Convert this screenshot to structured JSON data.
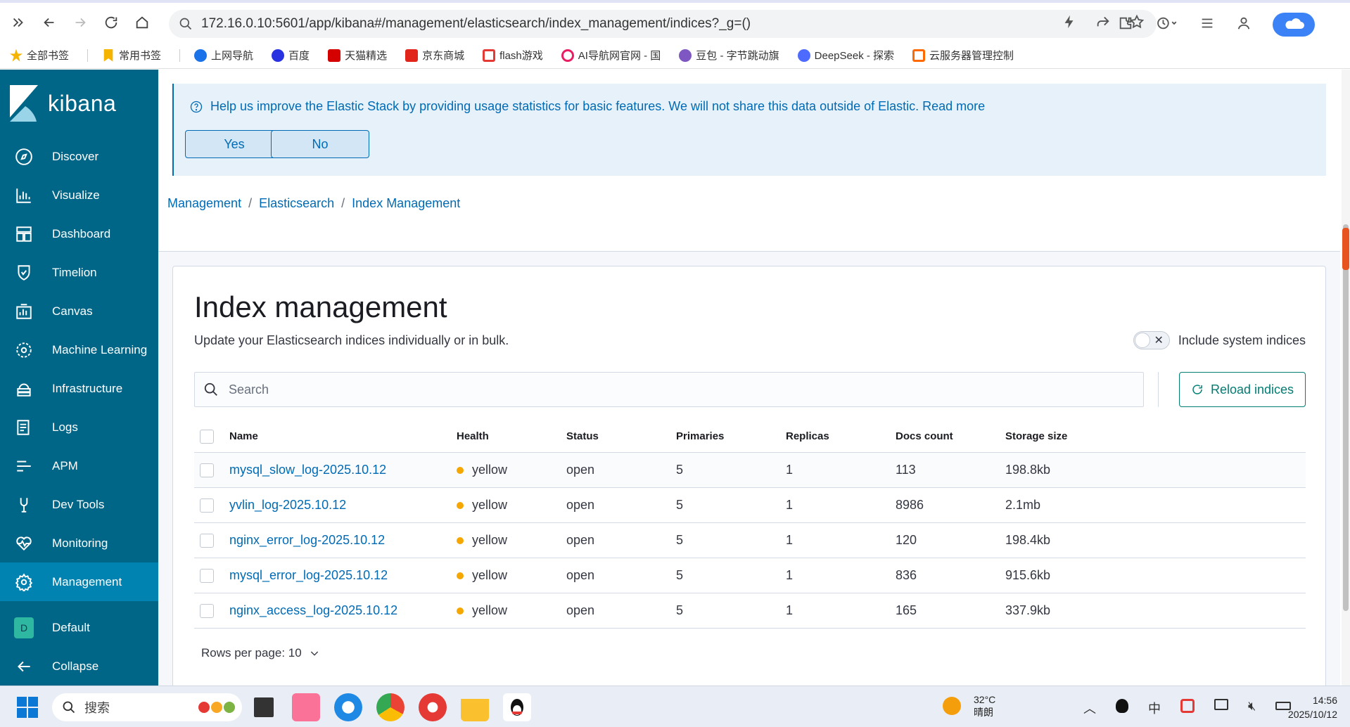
{
  "browser": {
    "url": "172.16.0.10:5601/app/kibana#/management/elasticsearch/index_management/indices?_g=()"
  },
  "bookmarks": [
    {
      "label": "全部书签",
      "color": "#f5b400"
    },
    {
      "label": "常用书签",
      "color": "#f5b400"
    },
    {
      "label": "上网导航",
      "color": "#1a73e8"
    },
    {
      "label": "百度",
      "color": "#2932e1"
    },
    {
      "label": "天猫精选",
      "color": "#d50000"
    },
    {
      "label": "京东商城",
      "color": "#e1251b"
    },
    {
      "label": "flash游戏",
      "color": "#e53935"
    },
    {
      "label": "AI导航网官网 - 国",
      "color": "#e91e63"
    },
    {
      "label": "豆包 - 字节跳动旗",
      "color": "#7e57c2"
    },
    {
      "label": "DeepSeek - 探索",
      "color": "#4d6bfe"
    },
    {
      "label": "云服务器管理控制",
      "color": "#ff6a00"
    }
  ],
  "sidebar": {
    "brand": "kibana",
    "items": [
      {
        "label": "Discover",
        "icon": "compass-icon"
      },
      {
        "label": "Visualize",
        "icon": "chart-icon"
      },
      {
        "label": "Dashboard",
        "icon": "dashboard-icon"
      },
      {
        "label": "Timelion",
        "icon": "shield-icon"
      },
      {
        "label": "Canvas",
        "icon": "canvas-icon"
      },
      {
        "label": "Machine Learning",
        "icon": "ml-icon"
      },
      {
        "label": "Infrastructure",
        "icon": "infra-icon"
      },
      {
        "label": "Logs",
        "icon": "logs-icon"
      },
      {
        "label": "APM",
        "icon": "apm-icon"
      },
      {
        "label": "Dev Tools",
        "icon": "wrench-icon"
      },
      {
        "label": "Monitoring",
        "icon": "heartbeat-icon"
      },
      {
        "label": "Management",
        "icon": "gear-icon"
      }
    ],
    "space_badge": "D",
    "space_label": "Default",
    "collapse_label": "Collapse"
  },
  "callout": {
    "text": "Help us improve the Elastic Stack by providing usage statistics for basic features. We will not share this data outside of Elastic. Read more",
    "yes_label": "Yes",
    "no_label": "No"
  },
  "breadcrumbs": {
    "b1": "Management",
    "b2": "Elasticsearch",
    "b3": "Index Management",
    "sep": "/"
  },
  "page": {
    "title": "Index management",
    "subtitle": "Update your Elasticsearch indices individually or in bulk.",
    "toggle_label": "Include system indices",
    "search_placeholder": "Search",
    "reload_label": "Reload indices",
    "rows_per_page": "Rows per page: 10"
  },
  "table": {
    "columns": {
      "name": "Name",
      "health": "Health",
      "status": "Status",
      "primaries": "Primaries",
      "replicas": "Replicas",
      "docs": "Docs count",
      "size": "Storage size"
    },
    "rows": [
      {
        "name": "mysql_slow_log-2025.10.12",
        "health": "yellow",
        "status": "open",
        "primaries": "5",
        "replicas": "1",
        "docs": "113",
        "size": "198.8kb"
      },
      {
        "name": "yvlin_log-2025.10.12",
        "health": "yellow",
        "status": "open",
        "primaries": "5",
        "replicas": "1",
        "docs": "8986",
        "size": "2.1mb"
      },
      {
        "name": "nginx_error_log-2025.10.12",
        "health": "yellow",
        "status": "open",
        "primaries": "5",
        "replicas": "1",
        "docs": "120",
        "size": "198.4kb"
      },
      {
        "name": "mysql_error_log-2025.10.12",
        "health": "yellow",
        "status": "open",
        "primaries": "5",
        "replicas": "1",
        "docs": "836",
        "size": "915.6kb"
      },
      {
        "name": "nginx_access_log-2025.10.12",
        "health": "yellow",
        "status": "open",
        "primaries": "5",
        "replicas": "1",
        "docs": "165",
        "size": "337.9kb"
      }
    ]
  },
  "taskbar": {
    "search_label": "搜索",
    "temperature": "32°C",
    "weather": "晴朗",
    "time": "14:56",
    "date": "2025/10/12",
    "ime": "中"
  },
  "colors": {
    "sidebar": "#006688",
    "sidebar_active": "#0083b0",
    "link": "#006bb4",
    "health_yellow": "#f5a700",
    "reload": "#017d73"
  }
}
